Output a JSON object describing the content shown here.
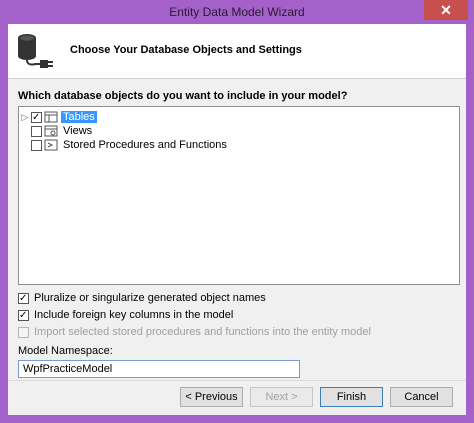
{
  "window": {
    "title": "Entity Data Model Wizard",
    "close_glyph": "✕"
  },
  "header": {
    "title": "Choose Your Database Objects and Settings",
    "icon": "database-plug-icon"
  },
  "tree": {
    "question": "Which database objects do you want to include in your model?",
    "items": [
      {
        "label": "Tables",
        "checked": true,
        "expander": "▷",
        "selected": true
      },
      {
        "label": "Views",
        "checked": false,
        "expander": "",
        "selected": false
      },
      {
        "label": "Stored Procedures and Functions",
        "checked": false,
        "expander": "",
        "selected": false
      }
    ]
  },
  "options": [
    {
      "label": "Pluralize or singularize generated object names",
      "checked": true,
      "disabled": false
    },
    {
      "label": "Include foreign key columns in the model",
      "checked": true,
      "disabled": false
    },
    {
      "label": "Import selected stored procedures and functions into the entity model",
      "checked": false,
      "disabled": true
    }
  ],
  "namespace": {
    "label": "Model Namespace:",
    "value": "WpfPracticeModel"
  },
  "buttons": {
    "previous": "< Previous",
    "next": "Next >",
    "finish": "Finish",
    "cancel": "Cancel"
  },
  "colors": {
    "window_frame": "#a461c9",
    "selection": "#3399ff",
    "close_button": "#c7504e"
  }
}
